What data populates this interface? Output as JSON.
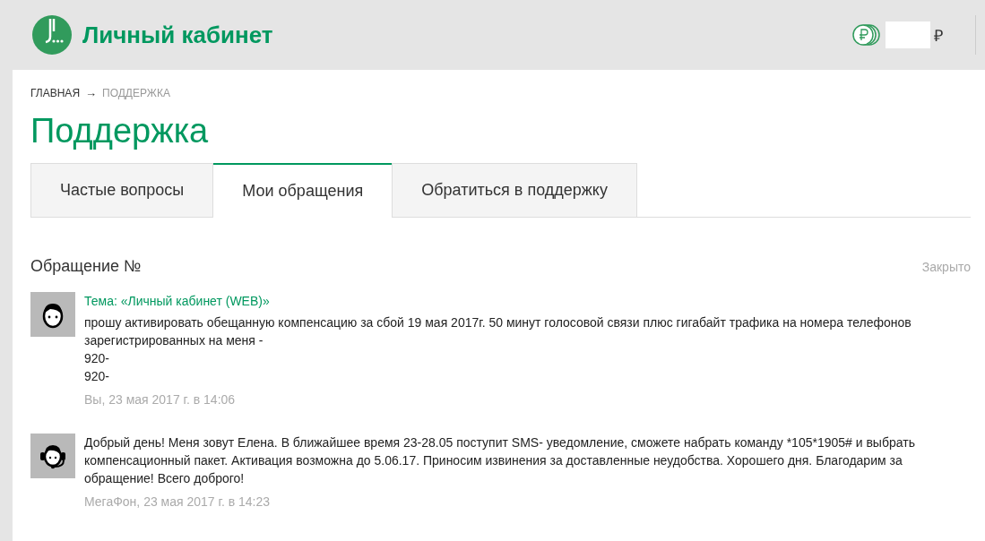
{
  "header": {
    "title": "Личный кабинет",
    "currency": "₽"
  },
  "breadcrumbs": [
    {
      "label": "ГЛАВНАЯ",
      "current": false
    },
    {
      "label": "ПОДДЕРЖКА",
      "current": true
    }
  ],
  "breadcrumb_separator": "→",
  "page_title": "Поддержка",
  "tabs": [
    {
      "label": "Частые вопросы",
      "selected": false
    },
    {
      "label": "Мои обращения",
      "selected": true
    },
    {
      "label": "Обратиться в поддержку",
      "selected": false
    }
  ],
  "ticket": {
    "title": "Обращение №",
    "status": "Закрыто"
  },
  "messages": [
    {
      "kind": "user",
      "topic": "Тема: «Личный кабинет (WEB)»",
      "lines": [
        "прошу активировать обещанную компенсацию за сбой 19 мая 2017г. 50 минут голосовой связи плюс гигабайт трафика на номера телефонов зарегистрированных на меня -",
        "920-",
        "920-"
      ],
      "meta": "Вы, 23 мая 2017 г. в 14:06"
    },
    {
      "kind": "operator",
      "lines": [
        "Добрый день! Меня зовут Елена. В ближайшее время 23-28.05 поступит SMS- уведомление, сможете набрать команду *105*1905# и выбрать компенсационный пакет. Активация возможна до 5.06.17. Приносим извинения за доставленные неудобства. Хорошего дня. Благодарим за обращение! Всего доброго!"
      ],
      "meta": "МегаФон, 23 мая 2017 г. в 14:23"
    }
  ]
}
